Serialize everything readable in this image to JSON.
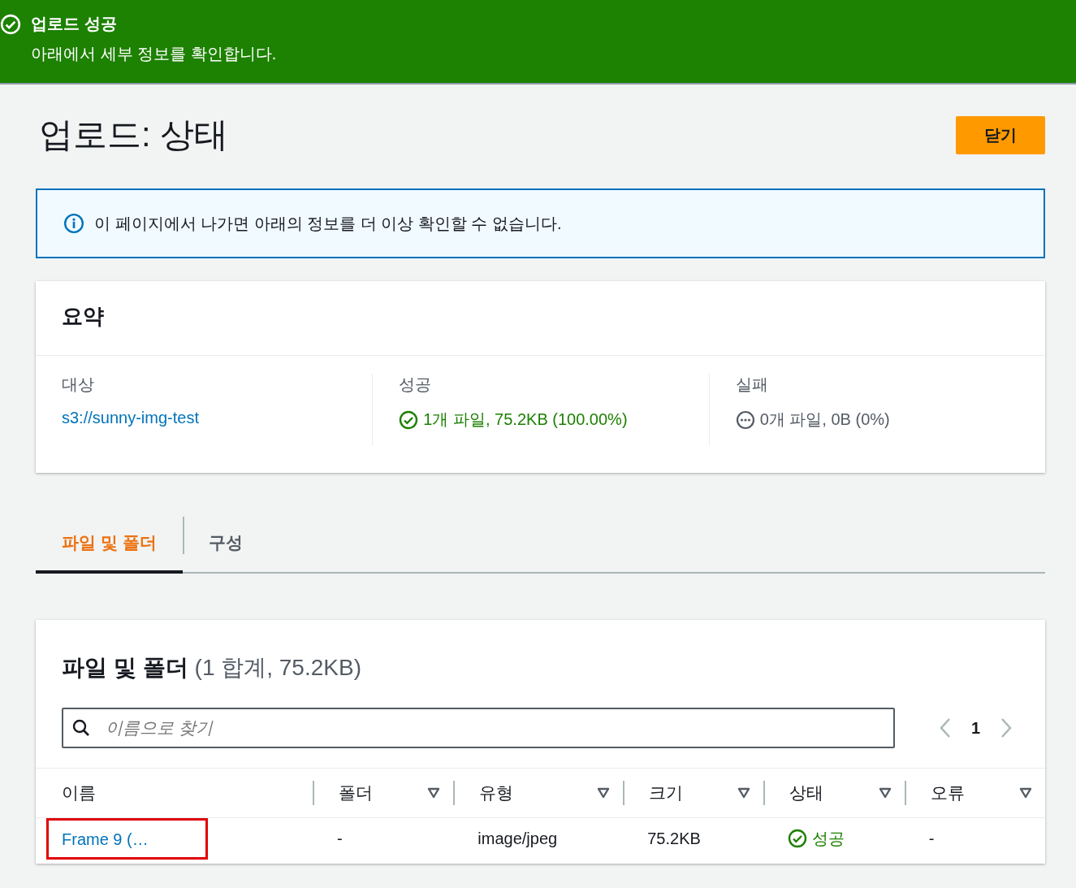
{
  "banner": {
    "title": "업로드 성공",
    "message": "아래에서 세부 정보를 확인합니다."
  },
  "header": {
    "title": "업로드: 상태",
    "button": "닫기"
  },
  "info": {
    "text": "이 페이지에서 나가면 아래의 정보를 더 이상 확인할 수 없습니다."
  },
  "summary": {
    "title": "요약",
    "items": [
      {
        "label": "대상",
        "value": "s3://sunny-img-test",
        "kind": "link"
      },
      {
        "label": "성공",
        "value": "1개 파일, 75.2KB (100.00%)",
        "kind": "success"
      },
      {
        "label": "실패",
        "value": "0개 파일, 0B (0%)",
        "kind": "pending"
      }
    ]
  },
  "tabs": [
    {
      "label": "파일 및 폴더",
      "selected": true
    },
    {
      "label": "구성",
      "selected": false
    }
  ],
  "files": {
    "title": "파일 및 폴더",
    "count": "(1 합계, 75.2KB)",
    "search": {
      "placeholder": "이름으로 찾기"
    },
    "page": "1",
    "columns": [
      {
        "label": "이름",
        "sortable": false
      },
      {
        "label": "폴더",
        "sortable": true
      },
      {
        "label": "유형",
        "sortable": true
      },
      {
        "label": "크기",
        "sortable": true
      },
      {
        "label": "상태",
        "sortable": true
      },
      {
        "label": "오류",
        "sortable": true
      }
    ],
    "rows": [
      {
        "name": "Frame 9 (…",
        "highlighted": true,
        "folder": "-",
        "type": "image/jpeg",
        "size": "75.2KB",
        "status": {
          "text": "성공",
          "kind": "success"
        },
        "error": "-"
      }
    ]
  }
}
